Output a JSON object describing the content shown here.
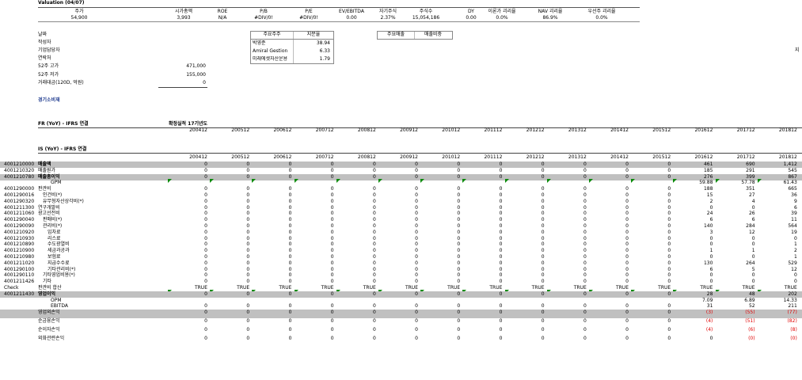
{
  "valuation": {
    "title": "Valuation (04/07)",
    "headers": [
      "주가",
      "시가총액",
      "ROE",
      "P/B",
      "P/E",
      "EV/EBITDA",
      "자기주식",
      "주식수",
      "DY",
      "이론가 괴리율",
      "NAV 괴리율",
      "우선주 괴리율"
    ],
    "values": [
      "54,900",
      "3,993",
      "N/A",
      "#DIV/0!",
      "#DIV/0!",
      "0.00",
      "2.37%",
      "15,054,186",
      "0.00",
      "0.0%",
      "86.9%",
      "0.0%"
    ]
  },
  "info": {
    "labels": [
      "날짜",
      "작성자",
      "기업담당자",
      "연락처",
      "52주 고가",
      "52주 저가",
      "거래대금(120D, 억원)"
    ],
    "values": [
      "",
      "",
      "",
      "",
      "471,000",
      "155,000",
      "0"
    ],
    "sector": "경기소비재"
  },
  "shareholders": {
    "header": [
      "주요주주",
      "지분율"
    ],
    "rows": [
      [
        "박영준",
        "38.94"
      ],
      [
        "Amiral Gestion",
        "6.33"
      ],
      [
        "미래에셋자산운용",
        "1.79"
      ]
    ]
  },
  "sales": {
    "header": [
      "주요매출",
      "매출비중"
    ]
  },
  "side_mark": "지",
  "fr": {
    "title": "FR (YoY) - IFRS 연결",
    "confirmed": "확정실적 17기년도",
    "years": [
      "200412",
      "200512",
      "200612",
      "200712",
      "200812",
      "200912",
      "201012",
      "201112",
      "201212",
      "201312",
      "201412",
      "201512",
      "201612",
      "201712",
      "201812"
    ]
  },
  "is": {
    "title": "IS (YoY) - IFRS 연결",
    "years": [
      "200412",
      "200512",
      "200612",
      "200712",
      "200812",
      "200912",
      "201012",
      "201112",
      "201212",
      "201312",
      "201412",
      "201512",
      "201612",
      "201712",
      "201812"
    ],
    "rows": [
      {
        "code": "4001210000",
        "label": "매출액",
        "values": [
          "0",
          "0",
          "0",
          "0",
          "0",
          "0",
          "0",
          "0",
          "0",
          "0",
          "0",
          "0",
          "461",
          "690",
          "1,412"
        ]
      },
      {
        "code": "4001210320",
        "label": "매출원가",
        "values": [
          "0",
          "0",
          "0",
          "0",
          "0",
          "0",
          "0",
          "0",
          "0",
          "0",
          "0",
          "0",
          "185",
          "291",
          "545"
        ]
      },
      {
        "code": "4001210780",
        "label": "매출총이익",
        "values": [
          "0",
          "0",
          "0",
          "0",
          "0",
          "0",
          "0",
          "0",
          "0",
          "0",
          "0",
          "0",
          "276",
          "399",
          "867"
        ]
      },
      {
        "code": "",
        "label": "GPM",
        "values": [
          "",
          "",
          "",
          "",
          "",
          "",
          "",
          "",
          "",
          "",
          "",
          "",
          "59.88",
          "57.78",
          "61.43"
        ]
      },
      {
        "code": "4001290000",
        "label": "판관비",
        "values": [
          "0",
          "0",
          "0",
          "0",
          "0",
          "0",
          "0",
          "0",
          "0",
          "0",
          "0",
          "0",
          "188",
          "351",
          "665"
        ]
      },
      {
        "code": "4001290016",
        "label": "인건비(*)",
        "values": [
          "0",
          "0",
          "0",
          "0",
          "0",
          "0",
          "0",
          "0",
          "0",
          "0",
          "0",
          "0",
          "15",
          "27",
          "36"
        ]
      },
      {
        "code": "4001290320",
        "label": "유무형자산상각비(*)",
        "values": [
          "0",
          "0",
          "0",
          "0",
          "0",
          "0",
          "0",
          "0",
          "0",
          "0",
          "0",
          "0",
          "2",
          "4",
          "9"
        ]
      },
      {
        "code": "4001211300",
        "label": "연구개발비",
        "values": [
          "0",
          "0",
          "0",
          "0",
          "0",
          "0",
          "0",
          "0",
          "0",
          "0",
          "0",
          "0",
          "0",
          "0",
          "6"
        ]
      },
      {
        "code": "4001211060",
        "label": "광고선전비",
        "values": [
          "0",
          "0",
          "0",
          "0",
          "0",
          "0",
          "0",
          "0",
          "0",
          "0",
          "0",
          "0",
          "24",
          "26",
          "39"
        ]
      },
      {
        "code": "4001290040",
        "label": "판매비(*)",
        "values": [
          "0",
          "0",
          "0",
          "0",
          "0",
          "0",
          "0",
          "0",
          "0",
          "0",
          "0",
          "0",
          "6",
          "6",
          "11"
        ]
      },
      {
        "code": "4001290090",
        "label": "관리비(*)",
        "values": [
          "0",
          "0",
          "0",
          "0",
          "0",
          "0",
          "0",
          "0",
          "0",
          "0",
          "0",
          "0",
          "140",
          "284",
          "564"
        ]
      },
      {
        "code": "4001210920",
        "label": "임차료",
        "values": [
          "0",
          "0",
          "0",
          "0",
          "0",
          "0",
          "0",
          "0",
          "0",
          "0",
          "0",
          "0",
          "3",
          "12",
          "19"
        ]
      },
      {
        "code": "4001210930",
        "label": "리스료",
        "values": [
          "0",
          "0",
          "0",
          "0",
          "0",
          "0",
          "0",
          "0",
          "0",
          "0",
          "0",
          "0",
          "0",
          "0",
          "0"
        ]
      },
      {
        "code": "4001210890",
        "label": "수도광열비",
        "values": [
          "0",
          "0",
          "0",
          "0",
          "0",
          "0",
          "0",
          "0",
          "0",
          "0",
          "0",
          "0",
          "0",
          "0",
          "1"
        ]
      },
      {
        "code": "4001210900",
        "label": "세금과공과",
        "values": [
          "0",
          "0",
          "0",
          "0",
          "0",
          "0",
          "0",
          "0",
          "0",
          "0",
          "0",
          "0",
          "1",
          "1",
          "2"
        ]
      },
      {
        "code": "4001210980",
        "label": "보험료",
        "values": [
          "0",
          "0",
          "0",
          "0",
          "0",
          "0",
          "0",
          "0",
          "0",
          "0",
          "0",
          "0",
          "0",
          "0",
          "1"
        ]
      },
      {
        "code": "4001211020",
        "label": "지급수수료",
        "values": [
          "0",
          "0",
          "0",
          "0",
          "0",
          "0",
          "0",
          "0",
          "0",
          "0",
          "0",
          "0",
          "130",
          "264",
          "529"
        ]
      },
      {
        "code": "4001290100",
        "label": "기타관리비(*)",
        "values": [
          "0",
          "0",
          "0",
          "0",
          "0",
          "0",
          "0",
          "0",
          "0",
          "0",
          "0",
          "0",
          "6",
          "5",
          "12"
        ]
      },
      {
        "code": "4001290110",
        "label": "기타영업비용(*)",
        "values": [
          "0",
          "0",
          "0",
          "0",
          "0",
          "0",
          "0",
          "0",
          "0",
          "0",
          "0",
          "0",
          "0",
          "0",
          "0"
        ]
      },
      {
        "code": "4001211426",
        "label": "기타",
        "values": [
          "0",
          "0",
          "0",
          "0",
          "0",
          "0",
          "0",
          "0",
          "0",
          "0",
          "0",
          "0",
          "0",
          "0",
          "0"
        ]
      },
      {
        "code": "Check",
        "label": "판관비 합산",
        "values": [
          "TRUE",
          "TRUE",
          "TRUE",
          "TRUE",
          "TRUE",
          "TRUE",
          "TRUE",
          "TRUE",
          "TRUE",
          "TRUE",
          "TRUE",
          "TRUE",
          "TRUE",
          "TRUE",
          "TRUE"
        ]
      },
      {
        "code": "4001211430",
        "label": "영업이익",
        "values": [
          "0",
          "0",
          "0",
          "0",
          "0",
          "0",
          "0",
          "0",
          "0",
          "0",
          "0",
          "0",
          "28",
          "48",
          "202"
        ]
      },
      {
        "code": "",
        "label": "OPM",
        "values": [
          "",
          "",
          "",
          "",
          "",
          "",
          "",
          "",
          "",
          "",
          "",
          "",
          "7.09",
          "6.89",
          "14.33"
        ]
      },
      {
        "code": "",
        "label": "EBITDA",
        "values": [
          "0",
          "0",
          "0",
          "0",
          "0",
          "0",
          "0",
          "0",
          "0",
          "0",
          "0",
          "0",
          "31",
          "52",
          "211"
        ]
      },
      {
        "code": "",
        "label": "영업외손익",
        "values": [
          "0",
          "0",
          "0",
          "0",
          "0",
          "0",
          "0",
          "0",
          "0",
          "0",
          "0",
          "0",
          "(3)",
          "(55)",
          "(77)"
        ]
      },
      {
        "code": "",
        "label": "순금융손익",
        "values": [
          "0",
          "0",
          "0",
          "0",
          "0",
          "0",
          "0",
          "0",
          "0",
          "0",
          "0",
          "0",
          "(4)",
          "(51)",
          "(82)"
        ]
      },
      {
        "code": "",
        "label": "순이자손익",
        "values": [
          "0",
          "0",
          "0",
          "0",
          "0",
          "0",
          "0",
          "0",
          "0",
          "0",
          "0",
          "0",
          "(4)",
          "(6)",
          "(8)"
        ]
      },
      {
        "code": "",
        "label": "외화관련손익",
        "values": [
          "0",
          "0",
          "0",
          "0",
          "0",
          "0",
          "0",
          "0",
          "0",
          "0",
          "0",
          "0",
          "0",
          "(0)",
          "(0)"
        ]
      }
    ]
  }
}
